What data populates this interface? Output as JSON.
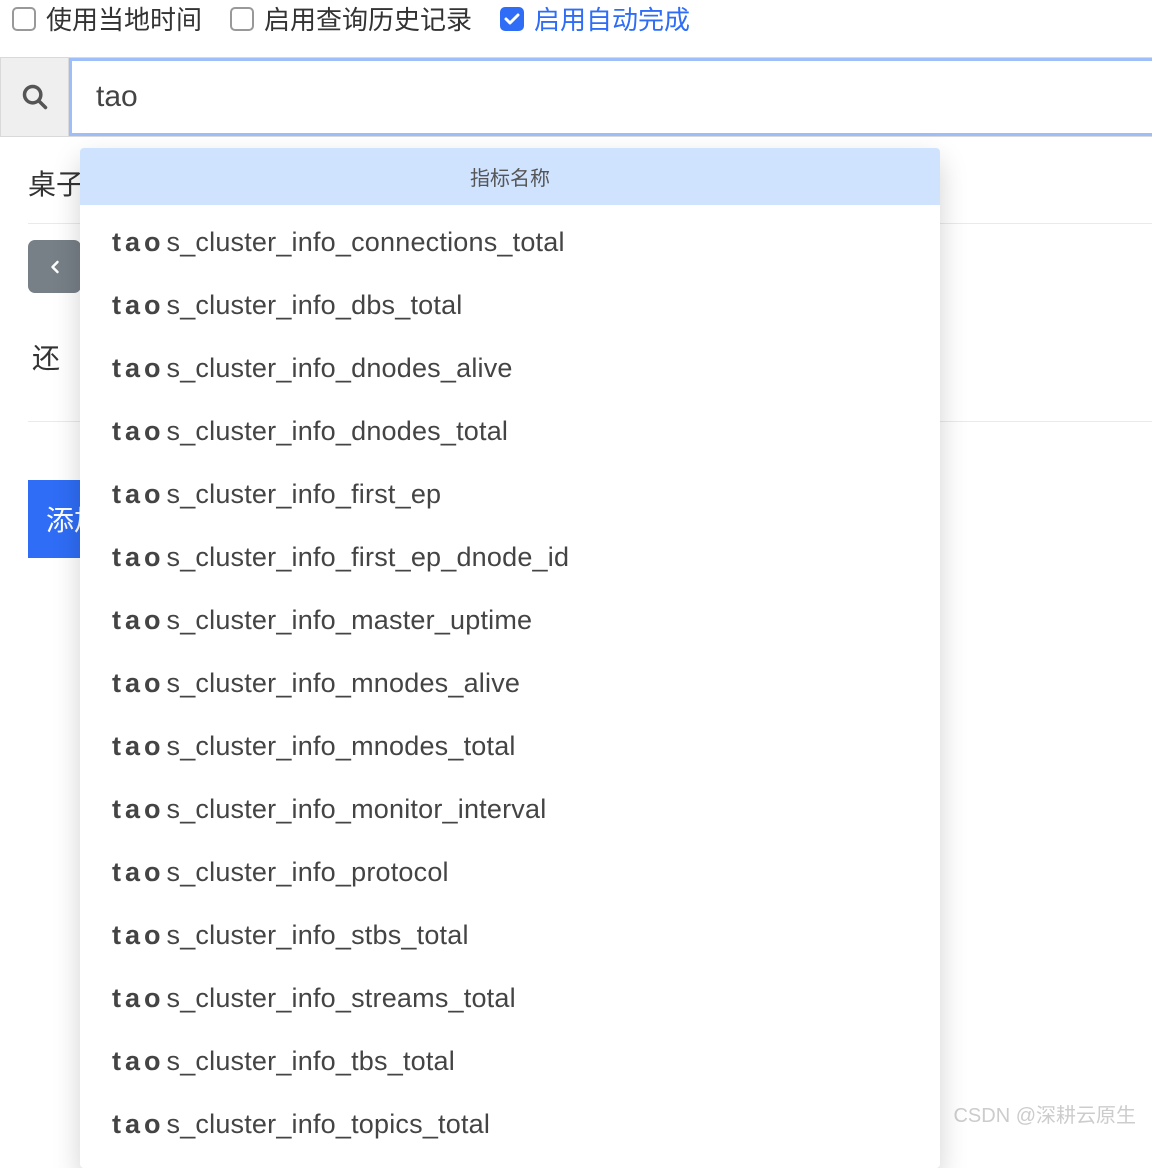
{
  "toolbar": {
    "local_time": {
      "label": "使用当地时间",
      "checked": false
    },
    "query_history": {
      "label": "启用查询历史记录",
      "checked": false
    },
    "autocomplete": {
      "label": "启用自动完成",
      "checked": true
    }
  },
  "search": {
    "value": "tao"
  },
  "under": {
    "table_label": "桌子",
    "remaining": "还",
    "add_label": "添加"
  },
  "autocomplete_panel": {
    "header": "指标名称",
    "match_prefix": "tao",
    "items": [
      "s_cluster_info_connections_total",
      "s_cluster_info_dbs_total",
      "s_cluster_info_dnodes_alive",
      "s_cluster_info_dnodes_total",
      "s_cluster_info_first_ep",
      "s_cluster_info_first_ep_dnode_id",
      "s_cluster_info_master_uptime",
      "s_cluster_info_mnodes_alive",
      "s_cluster_info_mnodes_total",
      "s_cluster_info_monitor_interval",
      "s_cluster_info_protocol",
      "s_cluster_info_stbs_total",
      "s_cluster_info_streams_total",
      "s_cluster_info_tbs_total",
      "s_cluster_info_topics_total"
    ]
  },
  "watermark": "CSDN @深耕云原生"
}
